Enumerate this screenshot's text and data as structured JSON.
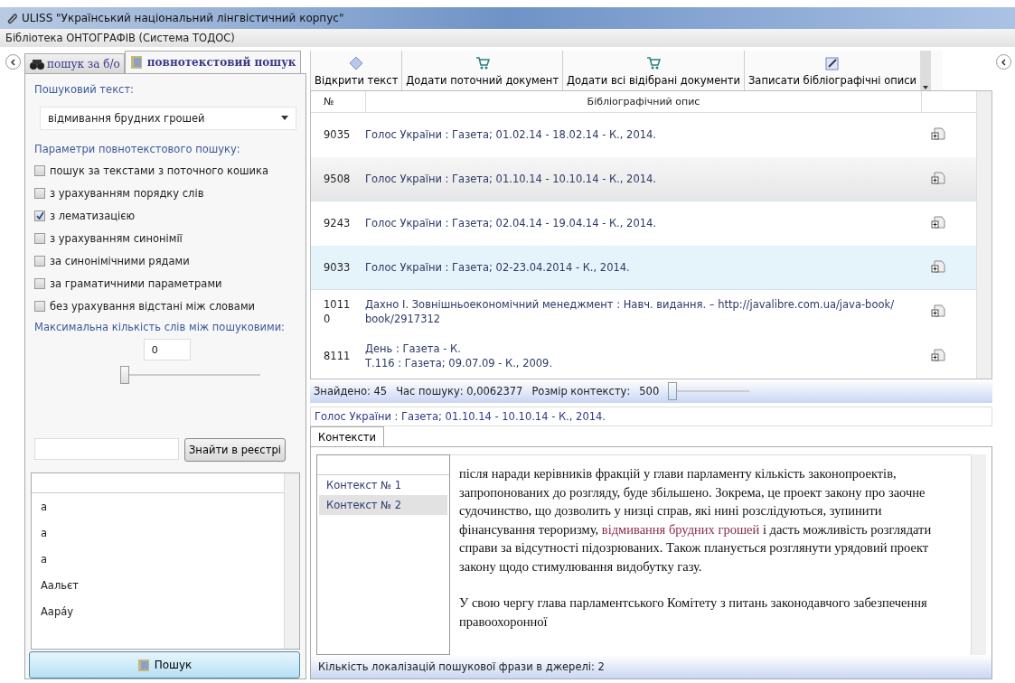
{
  "window": {
    "title": "ULISS \"Український національний лінгвістичний корпус\""
  },
  "menu_bar": {
    "title": "Бібліотека ОНТОГРАФІВ (Система ТОДОС)"
  },
  "left_panel": {
    "tabs": [
      {
        "label": "пошук за б/о",
        "selected": false
      },
      {
        "label": "повнотекстовий пошук",
        "selected": true
      }
    ],
    "search_text_label": "Пошуковий текст:",
    "search_text": {
      "value": "відмивання брудних грошей"
    },
    "params_label": "Параметри повнотекстового пошуку:",
    "options": [
      {
        "label": "пошук за текстами з поточного кошика",
        "checked": false
      },
      {
        "label": "з урахуванням порядку слів",
        "checked": false
      },
      {
        "label": "з лематизацією",
        "checked": true
      },
      {
        "label": "з урахуванням синонімії",
        "checked": false
      },
      {
        "label": "за синонімічними рядами",
        "checked": false
      },
      {
        "label": "за граматичними параметрами",
        "checked": false
      },
      {
        "label": "без урахування відстані між словами",
        "checked": false
      }
    ],
    "max_words_label": "Максимальна кількість слів між пошуковими:",
    "max_words": {
      "value": "0",
      "level": 0
    },
    "registry_button": "Знайти в реєстрі",
    "registry_list": [
      "а",
      "а",
      "а",
      "Аальєт",
      "Аарáу"
    ],
    "search_button": "Пошук"
  },
  "toolbar": [
    {
      "label": "Відкрити текст"
    },
    {
      "label": "Додати поточний документ"
    },
    {
      "label": "Додати всі відібрані документи"
    },
    {
      "label": "Записати бібліографічні описи"
    }
  ],
  "table": {
    "columns": [
      "№",
      "Бібліографічний опис"
    ],
    "rows": [
      {
        "number": "9035",
        "description": [
          "Голос України : Газета; 01.02.14 - 18.02.14 - К., 2014."
        ],
        "selected": false,
        "hovered": false
      },
      {
        "number": "9508",
        "description": [
          "Голос України : Газета; 01.10.14 - 10.10.14 - К., 2014."
        ],
        "selected": true,
        "hovered": false
      },
      {
        "number": "9243",
        "description": [
          "Голос України : Газета; 02.04.14 - 19.04.14 - К., 2014."
        ],
        "selected": false,
        "hovered": false
      },
      {
        "number": "9033",
        "description": [
          "Голос України : Газета; 02-23.04.2014 - К., 2014."
        ],
        "selected": false,
        "hovered": true
      },
      {
        "number": "10110",
        "description": [
          "Дахно І. Зовнішньоекономічний менеджмент : Навч. видання. – http://javalibre.com.ua/java-book/ book/2917312"
        ],
        "selected": false,
        "hovered": false
      },
      {
        "number": "8111",
        "description": [
          "День : Газета - К.",
          "Т.116 : Газета; 09.07.09 - К., 2009."
        ],
        "selected": false,
        "hovered": false
      }
    ]
  },
  "status": {
    "found": "Знайдено: 45",
    "time": "Час пошуку: 0,0062377",
    "context_size_label": "Розмір контексту:",
    "context_size": "500",
    "level": 0
  },
  "document_title": "Голос України : Газета; 01.10.14 - 10.10.14 - К., 2014.",
  "context_tabs": [
    {
      "label": "Контексти",
      "selected": true
    }
  ],
  "contexts": [
    {
      "label": "Контекст № 1",
      "selected": false
    },
    {
      "label": "Контекст № 2",
      "selected": true
    }
  ],
  "context_text": [
    [
      {
        "text": " після наради керівників фракцій у глави парламенту кількість законопроектів, запропонованих до розгляду, буде збільшено. Зокрема, це проект закону про заочне судочинство, що дозволить у низці справ, які нині розслідуються, зупинити фінансування тероризму, ",
        "highlight": false
      },
      {
        "text": "відмивання брудних грошей",
        "highlight": true
      },
      {
        "text": " і дасть можливість розглядати справи за відсутності підозрюваних. Також планується розглянути урядовий проект закону щодо стимулювання видобутку газу.",
        "highlight": false
      }
    ],
    [
      {
        "text": "У свою чергу глава парламентського Комітету з питань законодавчого забезпечення правоохоронної",
        "highlight": false
      }
    ]
  ],
  "footer": "Кількість локалізацій пошукової фрази в джерелі: 2"
}
